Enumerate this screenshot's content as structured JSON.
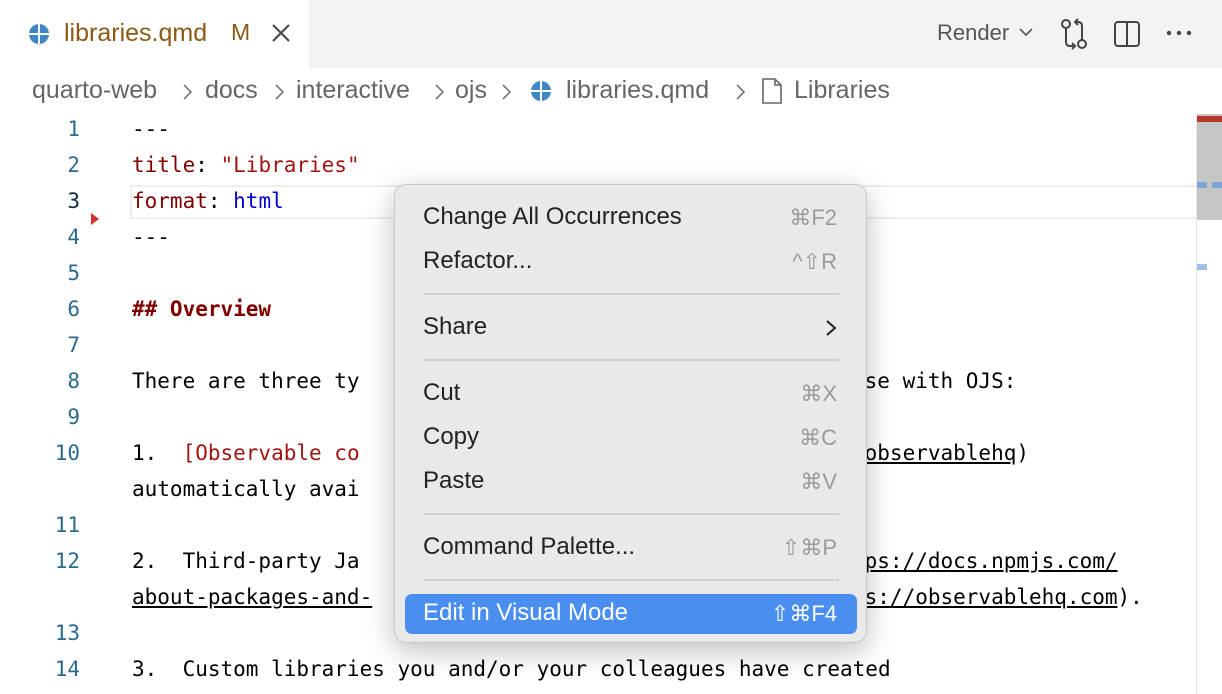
{
  "tab": {
    "label": "libraries.qmd",
    "modified": "M"
  },
  "toolbar": {
    "render_label": "Render"
  },
  "breadcrumb": [
    "quarto-web",
    "docs",
    "interactive",
    "ojs",
    "libraries.qmd",
    "Libraries"
  ],
  "gutter": [
    "1",
    "2",
    "3",
    "4",
    "5",
    "6",
    "7",
    "8",
    "9",
    "10",
    "",
    "11",
    "12",
    "",
    "13",
    "14"
  ],
  "code": {
    "l1": "---",
    "l2_key": "title",
    "l2_colon": ": ",
    "l2_val": "\"Libraries\"",
    "l3_key": "format",
    "l3_colon": ": ",
    "l3_val": "html",
    "l4": "---",
    "l6": "## Overview",
    "l8_a": "There are three ty",
    "l8_b": "use with OJS:",
    "l10_a": "1.  ",
    "l10_link": "[Observable co",
    "l10_b": "/observablehq",
    "l10_c": ")",
    "l10w": "automatically avai",
    "l12_a": "2.  Third-party Ja",
    "l12_b": "tps://docs.npmjs.com/",
    "l12w_a": "about-packages-and-",
    "l12w_b": "ps://observablehq.com",
    "l12w_c": ").",
    "l14": "3.  Custom libraries you and/or your colleagues have created"
  },
  "menu": {
    "items": [
      {
        "label": "Change All Occurrences",
        "shortcut": "⌘F2"
      },
      {
        "label": "Refactor...",
        "shortcut": "^⇧R"
      },
      {
        "label": "Share",
        "shortcut": ""
      },
      {
        "label": "Cut",
        "shortcut": "⌘X"
      },
      {
        "label": "Copy",
        "shortcut": "⌘C"
      },
      {
        "label": "Paste",
        "shortcut": "⌘V"
      },
      {
        "label": "Command Palette...",
        "shortcut": "⇧⌘P"
      },
      {
        "label": "Edit in Visual Mode",
        "shortcut": "⇧⌘F4"
      }
    ],
    "highlighted": "Edit in Visual Mode"
  },
  "colors": {
    "accent": "#4a8ff0",
    "tab_label": "#8a5a14",
    "yaml_key": "#800000",
    "yaml_value": "#0000cc",
    "string": "#a31515",
    "line_number": "#2b6a8f"
  },
  "icons": [
    "globe-icon",
    "close-icon",
    "chevron-down-icon",
    "git-compare-icon",
    "split-editor-icon",
    "more-icon",
    "chevron-right-icon",
    "file-icon",
    "breakpoint-icon"
  ]
}
